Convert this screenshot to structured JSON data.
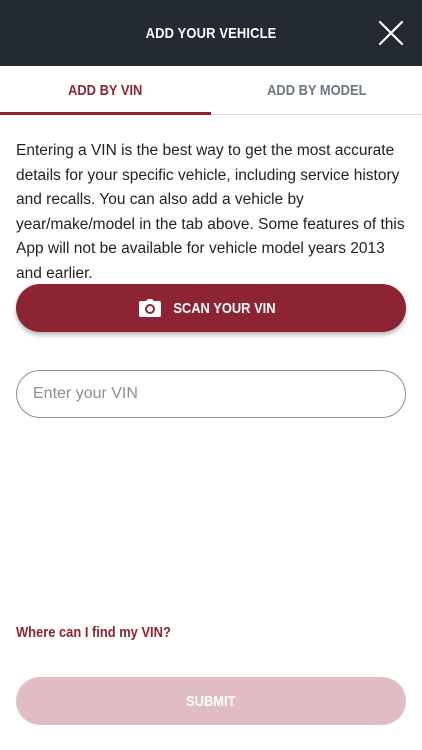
{
  "header": {
    "title": "ADD YOUR VEHICLE",
    "close_icon": "close-icon"
  },
  "tabs": [
    {
      "label": "ADD BY VIN",
      "active": true
    },
    {
      "label": "ADD BY MODEL",
      "active": false
    }
  ],
  "intro_text": "Entering a VIN is the best way to get the most accurate details for your specific vehicle, including service history and recalls. You can also add a vehicle by year/make/model in the tab above. Some features of this App will not be available for vehicle model years 2013 and earlier.",
  "scan_button": {
    "label": "SCAN YOUR VIN",
    "icon": "camera-icon"
  },
  "vin_input": {
    "placeholder": "Enter your VIN",
    "value": ""
  },
  "help_link": "Where can I find my VIN?",
  "submit_button": {
    "label": "SUBMIT",
    "enabled": false
  },
  "colors": {
    "header_bg": "#232a31",
    "accent": "#8c2434",
    "submit_disabled": "#e1bdc3",
    "inactive_tab": "#6b7680"
  }
}
